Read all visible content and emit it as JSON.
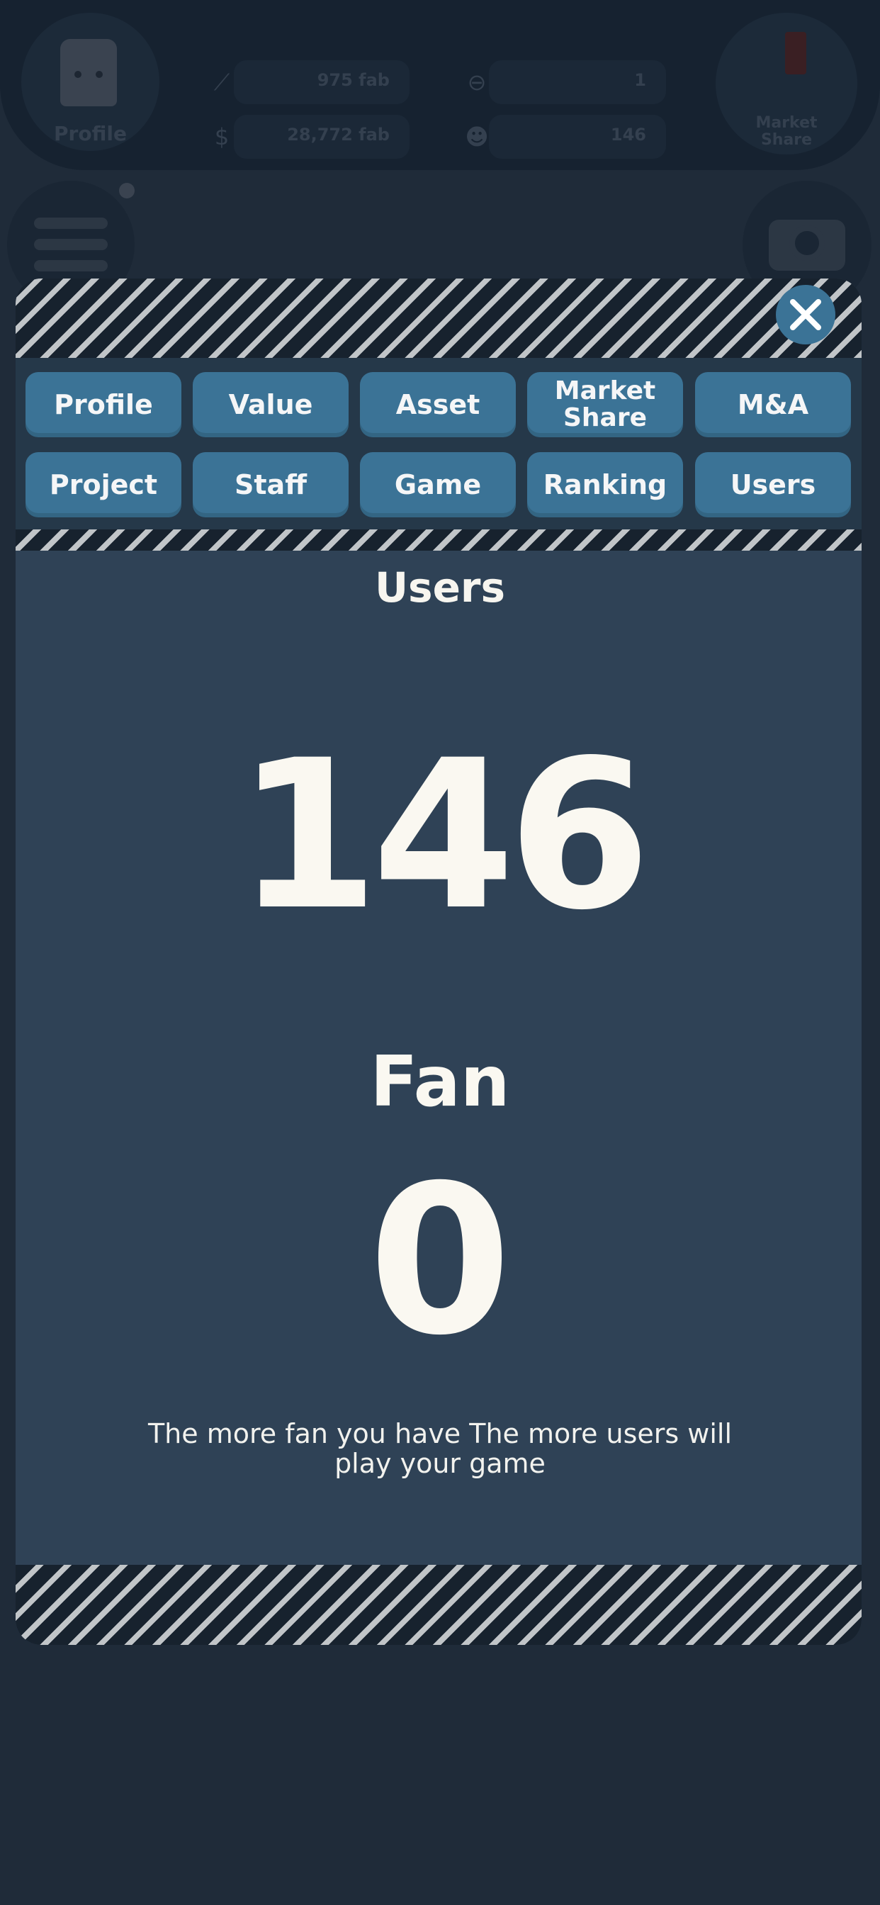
{
  "hud": {
    "profile_label": "Profile",
    "stats": [
      {
        "icon": "trend-icon",
        "value": "975 fab"
      },
      {
        "icon": "gamepad-icon",
        "value": "1"
      },
      {
        "icon": "money-icon",
        "value": "28,772 fab"
      },
      {
        "icon": "users-icon",
        "value": "146"
      }
    ],
    "market_label": "Market\nShare"
  },
  "tabs": [
    {
      "label": "Profile"
    },
    {
      "label": "Value"
    },
    {
      "label": "Asset"
    },
    {
      "label": "Market\nShare"
    },
    {
      "label": "M&A"
    },
    {
      "label": "Project"
    },
    {
      "label": "Staff"
    },
    {
      "label": "Game"
    },
    {
      "label": "Ranking"
    },
    {
      "label": "Users"
    }
  ],
  "content": {
    "title": "Users",
    "users_count": "146",
    "fan_label": "Fan",
    "fan_count": "0",
    "note": "The more fan you have The more users will play your game"
  },
  "colors": {
    "tab": "#3b7396",
    "panel": "#2f4256",
    "hazard_light": "#c1c5c8",
    "hazard_dark": "#17222e"
  }
}
